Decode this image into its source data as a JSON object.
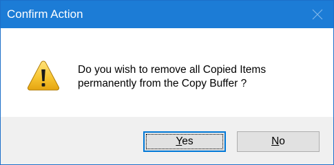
{
  "window": {
    "title": "Confirm Action",
    "accent_color": "#1c7cd6"
  },
  "titlebar": {
    "close_icon": "close-icon"
  },
  "dialog": {
    "icon": "warning-icon",
    "message_line1": "Do you wish to remove all Copied Items",
    "message_line2": "permanently from the Copy Buffer ?"
  },
  "buttons": {
    "yes": {
      "mnemonic": "Y",
      "rest": "es",
      "is_default": true
    },
    "no": {
      "mnemonic": "N",
      "rest": "o",
      "is_default": false
    }
  }
}
